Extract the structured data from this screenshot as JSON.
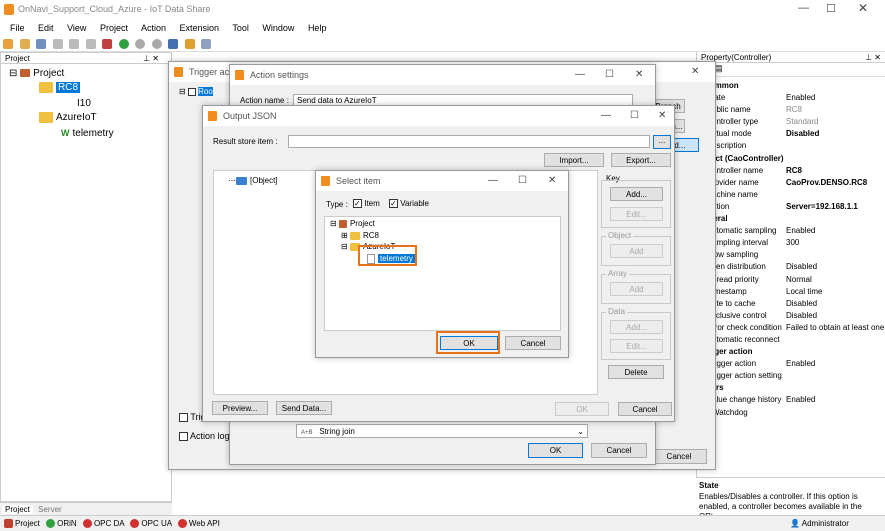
{
  "app": {
    "title": "OnNavi_Support_Cloud_Azure - IoT Data Share"
  },
  "menu": [
    "File",
    "Edit",
    "View",
    "Project",
    "Action",
    "Extension",
    "Tool",
    "Window",
    "Help"
  ],
  "project_panel": {
    "title": "Project",
    "tree": {
      "root": "Project",
      "rc8": "RC8",
      "i10": "I10",
      "azure": "AzureIoT",
      "telemetry": "telemetry"
    },
    "tabs": [
      "Project",
      "Server"
    ]
  },
  "trigger_window": {
    "title": "Trigger action",
    "root_item": "Roo",
    "cb1": "Trig",
    "cb2": "Action log",
    "buttons": [
      "Branch",
      "Action...",
      "Add...",
      "...",
      "..."
    ],
    "cancel": "Cancel"
  },
  "action_settings": {
    "title": "Action settings",
    "name_label": "Action name :",
    "name_value": "Send data to AzureIoT",
    "dropdown_icon": "A+B",
    "dropdown_value": "String join",
    "ok": "OK",
    "cancel": "Cancel"
  },
  "output_json": {
    "title": "Output JSON",
    "result_label": "Result store item :",
    "browse": "...",
    "import": "Import...",
    "export": "Export...",
    "tree_item": "[Object]",
    "key_group": "Key",
    "key_add": "Add...",
    "key_edit": "Edit...",
    "object_group": "Object",
    "object_add": "Add",
    "array_group": "Array",
    "array_add": "Add",
    "data_group": "Data",
    "data_add": "Add...",
    "data_edit": "Edit...",
    "delete": "Delete",
    "preview": "Preview...",
    "send": "Send Data...",
    "ok": "OK",
    "cancel": "Cancel"
  },
  "select_item": {
    "title": "Select item",
    "type_label": "Type :",
    "item_label": "Item",
    "variable_label": "Variable",
    "tree": {
      "root": "Project",
      "rc8": "RC8",
      "azure": "AzureIoT",
      "telemetry": "telemetry"
    },
    "ok": "OK",
    "cancel": "Cancel"
  },
  "property": {
    "title": "Property(Controller)",
    "rows": [
      {
        "cat": "Common"
      },
      {
        "k": "tate",
        "v": "Enabled"
      },
      {
        "k": "ublic name",
        "v": "RC8",
        "gray": true
      },
      {
        "k": "ontroller type",
        "v": "Standard",
        "gray": true
      },
      {
        "k": "irtual mode",
        "v": "Disabled",
        "bold": true
      },
      {
        "k": "escription",
        "v": ""
      },
      {
        "cat": "bject (CaoController)"
      },
      {
        "k": "ontroller name",
        "v": "RC8",
        "bold": true
      },
      {
        "k": "rovider name",
        "v": "CaoProv.DENSO.RC8",
        "bold": true
      },
      {
        "k": "achine name",
        "v": ""
      },
      {
        "k": "ption",
        "v": "Server=192.168.1.1",
        "bold": true
      },
      {
        "cat": "eneral"
      },
      {
        "k": "utomatic sampling",
        "v": "Enabled"
      },
      {
        "k": "ampling interval",
        "v": "300"
      },
      {
        "k": "low sampling",
        "v": ""
      },
      {
        "k": "ven distribution",
        "v": "Disabled"
      },
      {
        "k": "hread priority",
        "v": "Normal"
      },
      {
        "k": "imestamp",
        "v": "Local time"
      },
      {
        "k": "rite to cache",
        "v": "Disabled"
      },
      {
        "k": "xclusive control",
        "v": "Disabled"
      },
      {
        "k": "rror check condition",
        "v": "Failed to obtain at least one"
      },
      {
        "k": "utomatic reconnect",
        "v": ""
      },
      {
        "cat": "rigger action"
      },
      {
        "k": "rigger action",
        "v": "Enabled"
      },
      {
        "k": "rigger action setting",
        "v": ""
      },
      {
        "cat": "thers"
      },
      {
        "k": "alue change history",
        "v": "Enabled"
      },
      {
        "k": "Watchdog",
        "v": ""
      }
    ],
    "desc_title": "State",
    "desc_text": "Enables/Disables a controller. If this option is enabled, a controller becomes available in the ORi..."
  },
  "status": {
    "project": "Project",
    "orin": "ORiN",
    "opcda": "OPC DA",
    "opcua": "OPC UA",
    "webapi": "Web API",
    "user": "Administrator"
  }
}
